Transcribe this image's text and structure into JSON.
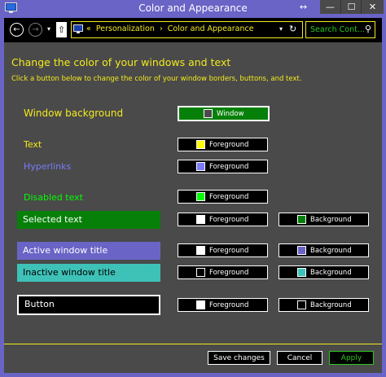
{
  "window": {
    "title": "Color and Appearance",
    "restore_glyph": "↔",
    "min_glyph": "—",
    "max_glyph": "☐",
    "close_glyph": "✕"
  },
  "nav": {
    "back_glyph": "←",
    "forward_glyph": "→",
    "dropdown_glyph": "▾",
    "up_glyph": "⇧",
    "address_sep": "«",
    "breadcrumb_1": "Personalization",
    "breadcrumb_sep": "›",
    "breadcrumb_2": "Color and Appearance",
    "address_drop_glyph": "▾",
    "refresh_glyph": "↻",
    "search_placeholder": "Search Cont...",
    "search_glyph": "⚲"
  },
  "content": {
    "heading": "Change the color of your windows and text",
    "subheading": "Click a button below to change the color of your window borders, buttons, and text."
  },
  "rows": {
    "window_background": {
      "label": "Window background",
      "button_label": "Window",
      "swatch": "#4a4a4a"
    },
    "text": {
      "label": "Text",
      "fg_label": "Foreground",
      "fg_swatch": "#ffff00"
    },
    "hyperlinks": {
      "label": "Hyperlinks",
      "fg_label": "Foreground",
      "fg_swatch": "#7b7bfb"
    },
    "disabled_text": {
      "label": "Disabled text",
      "fg_label": "Foreground",
      "fg_swatch": "#00ff00"
    },
    "selected_text": {
      "label": "Selected text",
      "fg_label": "Foreground",
      "fg_swatch": "#ffffff",
      "bg_label": "Background",
      "bg_swatch": "#07800a"
    },
    "active_title": {
      "label": "Active window title",
      "fg_label": "Foreground",
      "fg_swatch": "#ffffff",
      "bg_label": "Background",
      "bg_swatch": "#6a64c6"
    },
    "inactive_title": {
      "label": "Inactive window title",
      "fg_label": "Foreground",
      "fg_swatch": "#000000",
      "bg_label": "Background",
      "bg_swatch": "#3ec2b8"
    },
    "button": {
      "label": "Button",
      "fg_label": "Foreground",
      "fg_swatch": "#ffffff",
      "bg_label": "Background",
      "bg_swatch": "#000000"
    }
  },
  "footer": {
    "save_label": "Save changes",
    "cancel_label": "Cancel",
    "apply_label": "Apply"
  },
  "colors": {
    "frame": "#6a64c6",
    "content_bg": "#4a4a4a",
    "accent_yellow": "#f3ea1e",
    "accent_green": "#2ac81c",
    "hyperlink": "#7b7bfb",
    "disabled": "#00ff00",
    "selected_bg": "#07800a",
    "inactive_bg": "#3ec2b8"
  }
}
